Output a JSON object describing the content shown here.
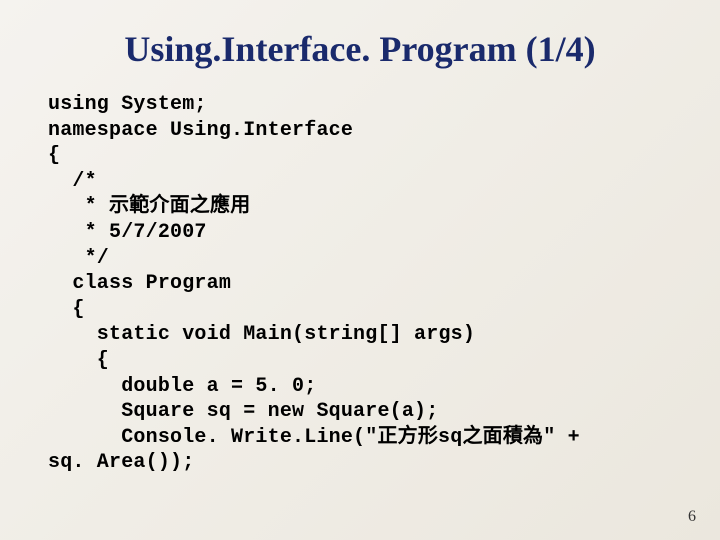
{
  "slide": {
    "title": "Using.Interface. Program (1/4)",
    "page_number": "6"
  },
  "code": {
    "lines": [
      "using System;",
      "namespace Using.Interface",
      "{",
      "  /*",
      "   * 示範介面之應用",
      "   * 5/7/2007",
      "   */",
      "  class Program",
      "  {",
      "    static void Main(string[] args)",
      "    {",
      "      double a = 5. 0;",
      "      Square sq = new Square(a);",
      "      Console. Write.Line(\"正方形sq之面積為\" +",
      "sq. Area());"
    ]
  }
}
